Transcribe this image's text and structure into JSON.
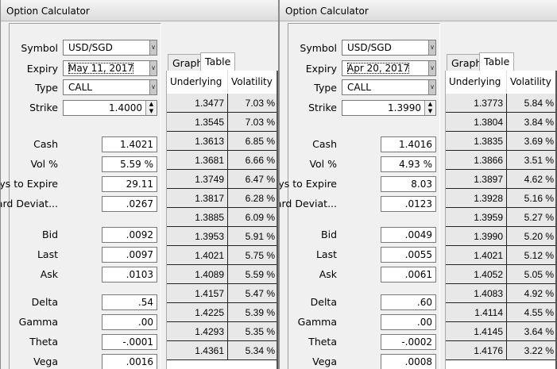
{
  "windows": [
    {
      "title": "Option Calculator",
      "labels": {
        "symbol": "Symbol",
        "expiry": "Expiry",
        "type": "Type",
        "strike": "Strike",
        "cash": "Cash",
        "vol": "Vol %",
        "days": "Days to Expire",
        "std": "Standard Deviat...",
        "bid": "Bid",
        "last": "Last",
        "ask": "Ask",
        "delta": "Delta",
        "gamma": "Gamma",
        "theta": "Theta",
        "vega": "Vega"
      },
      "values": {
        "symbol": "USD/SGD",
        "expiry": "May 11, 2017",
        "type": "CALL",
        "strike": "1.4000",
        "cash": "1.4021",
        "vol": "5.59 %",
        "days": "29.11",
        "std": ".0267",
        "bid": ".0092",
        "last": ".0097",
        "ask": ".0103",
        "delta": ".54",
        "gamma": ".00",
        "theta": "-.0001",
        "vega": ".0016"
      },
      "tabs": [
        "Graph",
        "Table"
      ],
      "columns": [
        "Underlying",
        "Volatility"
      ],
      "rows": [
        [
          "1.3477",
          "7.03 %"
        ],
        [
          "1.3545",
          "7.03 %"
        ],
        [
          "1.3613",
          "6.85 %"
        ],
        [
          "1.3681",
          "6.66 %"
        ],
        [
          "1.3749",
          "6.47 %"
        ],
        [
          "1.3817",
          "6.28 %"
        ],
        [
          "1.3885",
          "6.09 %"
        ],
        [
          "1.3953",
          "5.91 %"
        ],
        [
          "1.4021",
          "5.75 %"
        ],
        [
          "1.4089",
          "5.59 %"
        ],
        [
          "1.4157",
          "5.47 %"
        ],
        [
          "1.4225",
          "5.39 %"
        ],
        [
          "1.4293",
          "5.35 %"
        ],
        [
          "1.4361",
          "5.34 %"
        ]
      ]
    },
    {
      "title": "Option Calculator",
      "labels": {
        "symbol": "Symbol",
        "expiry": "Expiry",
        "type": "Type",
        "strike": "Strike",
        "cash": "Cash",
        "vol": "Vol %",
        "days": "Days to Expire",
        "std": "Standard Deviat...",
        "bid": "Bid",
        "last": "Last",
        "ask": "Ask",
        "delta": "Delta",
        "gamma": "Gamma",
        "theta": "Theta",
        "vega": "Vega"
      },
      "values": {
        "symbol": "USD/SGD",
        "expiry": "Apr 20, 2017",
        "type": "CALL",
        "strike": "1.3990",
        "cash": "1.4016",
        "vol": "4.93 %",
        "days": "8.03",
        "std": ".0123",
        "bid": ".0049",
        "last": ".0055",
        "ask": ".0061",
        "delta": ".60",
        "gamma": ".00",
        "theta": "-.0002",
        "vega": ".0008"
      },
      "tabs": [
        "Graph",
        "Table"
      ],
      "columns": [
        "Underlying",
        "Volatility"
      ],
      "rows": [
        [
          "1.3773",
          "5.84 %"
        ],
        [
          "1.3804",
          "3.84 %"
        ],
        [
          "1.3835",
          "3.69 %"
        ],
        [
          "1.3866",
          "3.51 %"
        ],
        [
          "1.3897",
          "4.62 %"
        ],
        [
          "1.3928",
          "5.16 %"
        ],
        [
          "1.3959",
          "5.27 %"
        ],
        [
          "1.3990",
          "5.20 %"
        ],
        [
          "1.4021",
          "5.12 %"
        ],
        [
          "1.4052",
          "5.05 %"
        ],
        [
          "1.4083",
          "4.92 %"
        ],
        [
          "1.4114",
          "4.55 %"
        ],
        [
          "1.4145",
          "3.64 %"
        ],
        [
          "1.4176",
          "3.22 %"
        ]
      ]
    }
  ]
}
